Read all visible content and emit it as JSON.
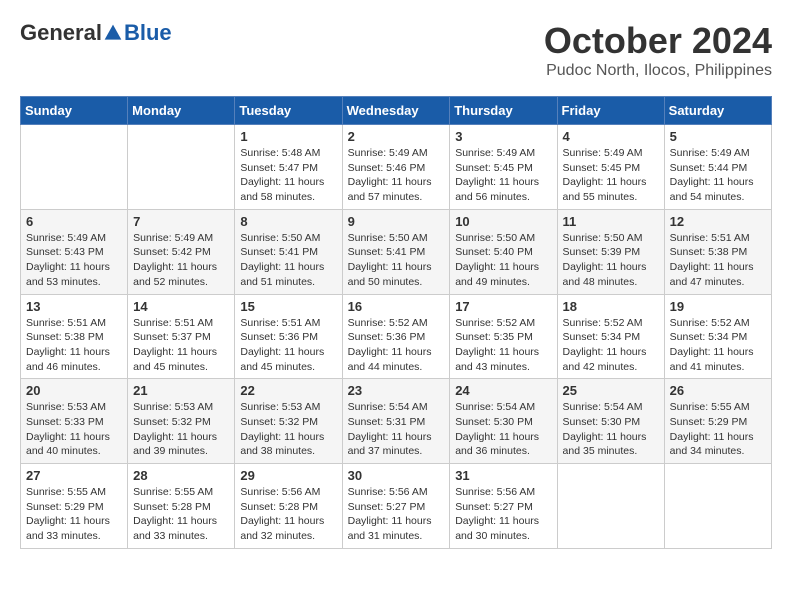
{
  "logo": {
    "general": "General",
    "blue": "Blue"
  },
  "title": "October 2024",
  "location": "Pudoc North, Ilocos, Philippines",
  "weekdays": [
    "Sunday",
    "Monday",
    "Tuesday",
    "Wednesday",
    "Thursday",
    "Friday",
    "Saturday"
  ],
  "weeks": [
    [
      {
        "day": null
      },
      {
        "day": null
      },
      {
        "day": "1",
        "sunrise": "Sunrise: 5:48 AM",
        "sunset": "Sunset: 5:47 PM",
        "daylight": "Daylight: 11 hours and 58 minutes."
      },
      {
        "day": "2",
        "sunrise": "Sunrise: 5:49 AM",
        "sunset": "Sunset: 5:46 PM",
        "daylight": "Daylight: 11 hours and 57 minutes."
      },
      {
        "day": "3",
        "sunrise": "Sunrise: 5:49 AM",
        "sunset": "Sunset: 5:45 PM",
        "daylight": "Daylight: 11 hours and 56 minutes."
      },
      {
        "day": "4",
        "sunrise": "Sunrise: 5:49 AM",
        "sunset": "Sunset: 5:45 PM",
        "daylight": "Daylight: 11 hours and 55 minutes."
      },
      {
        "day": "5",
        "sunrise": "Sunrise: 5:49 AM",
        "sunset": "Sunset: 5:44 PM",
        "daylight": "Daylight: 11 hours and 54 minutes."
      }
    ],
    [
      {
        "day": "6",
        "sunrise": "Sunrise: 5:49 AM",
        "sunset": "Sunset: 5:43 PM",
        "daylight": "Daylight: 11 hours and 53 minutes."
      },
      {
        "day": "7",
        "sunrise": "Sunrise: 5:49 AM",
        "sunset": "Sunset: 5:42 PM",
        "daylight": "Daylight: 11 hours and 52 minutes."
      },
      {
        "day": "8",
        "sunrise": "Sunrise: 5:50 AM",
        "sunset": "Sunset: 5:41 PM",
        "daylight": "Daylight: 11 hours and 51 minutes."
      },
      {
        "day": "9",
        "sunrise": "Sunrise: 5:50 AM",
        "sunset": "Sunset: 5:41 PM",
        "daylight": "Daylight: 11 hours and 50 minutes."
      },
      {
        "day": "10",
        "sunrise": "Sunrise: 5:50 AM",
        "sunset": "Sunset: 5:40 PM",
        "daylight": "Daylight: 11 hours and 49 minutes."
      },
      {
        "day": "11",
        "sunrise": "Sunrise: 5:50 AM",
        "sunset": "Sunset: 5:39 PM",
        "daylight": "Daylight: 11 hours and 48 minutes."
      },
      {
        "day": "12",
        "sunrise": "Sunrise: 5:51 AM",
        "sunset": "Sunset: 5:38 PM",
        "daylight": "Daylight: 11 hours and 47 minutes."
      }
    ],
    [
      {
        "day": "13",
        "sunrise": "Sunrise: 5:51 AM",
        "sunset": "Sunset: 5:38 PM",
        "daylight": "Daylight: 11 hours and 46 minutes."
      },
      {
        "day": "14",
        "sunrise": "Sunrise: 5:51 AM",
        "sunset": "Sunset: 5:37 PM",
        "daylight": "Daylight: 11 hours and 45 minutes."
      },
      {
        "day": "15",
        "sunrise": "Sunrise: 5:51 AM",
        "sunset": "Sunset: 5:36 PM",
        "daylight": "Daylight: 11 hours and 45 minutes."
      },
      {
        "day": "16",
        "sunrise": "Sunrise: 5:52 AM",
        "sunset": "Sunset: 5:36 PM",
        "daylight": "Daylight: 11 hours and 44 minutes."
      },
      {
        "day": "17",
        "sunrise": "Sunrise: 5:52 AM",
        "sunset": "Sunset: 5:35 PM",
        "daylight": "Daylight: 11 hours and 43 minutes."
      },
      {
        "day": "18",
        "sunrise": "Sunrise: 5:52 AM",
        "sunset": "Sunset: 5:34 PM",
        "daylight": "Daylight: 11 hours and 42 minutes."
      },
      {
        "day": "19",
        "sunrise": "Sunrise: 5:52 AM",
        "sunset": "Sunset: 5:34 PM",
        "daylight": "Daylight: 11 hours and 41 minutes."
      }
    ],
    [
      {
        "day": "20",
        "sunrise": "Sunrise: 5:53 AM",
        "sunset": "Sunset: 5:33 PM",
        "daylight": "Daylight: 11 hours and 40 minutes."
      },
      {
        "day": "21",
        "sunrise": "Sunrise: 5:53 AM",
        "sunset": "Sunset: 5:32 PM",
        "daylight": "Daylight: 11 hours and 39 minutes."
      },
      {
        "day": "22",
        "sunrise": "Sunrise: 5:53 AM",
        "sunset": "Sunset: 5:32 PM",
        "daylight": "Daylight: 11 hours and 38 minutes."
      },
      {
        "day": "23",
        "sunrise": "Sunrise: 5:54 AM",
        "sunset": "Sunset: 5:31 PM",
        "daylight": "Daylight: 11 hours and 37 minutes."
      },
      {
        "day": "24",
        "sunrise": "Sunrise: 5:54 AM",
        "sunset": "Sunset: 5:30 PM",
        "daylight": "Daylight: 11 hours and 36 minutes."
      },
      {
        "day": "25",
        "sunrise": "Sunrise: 5:54 AM",
        "sunset": "Sunset: 5:30 PM",
        "daylight": "Daylight: 11 hours and 35 minutes."
      },
      {
        "day": "26",
        "sunrise": "Sunrise: 5:55 AM",
        "sunset": "Sunset: 5:29 PM",
        "daylight": "Daylight: 11 hours and 34 minutes."
      }
    ],
    [
      {
        "day": "27",
        "sunrise": "Sunrise: 5:55 AM",
        "sunset": "Sunset: 5:29 PM",
        "daylight": "Daylight: 11 hours and 33 minutes."
      },
      {
        "day": "28",
        "sunrise": "Sunrise: 5:55 AM",
        "sunset": "Sunset: 5:28 PM",
        "daylight": "Daylight: 11 hours and 33 minutes."
      },
      {
        "day": "29",
        "sunrise": "Sunrise: 5:56 AM",
        "sunset": "Sunset: 5:28 PM",
        "daylight": "Daylight: 11 hours and 32 minutes."
      },
      {
        "day": "30",
        "sunrise": "Sunrise: 5:56 AM",
        "sunset": "Sunset: 5:27 PM",
        "daylight": "Daylight: 11 hours and 31 minutes."
      },
      {
        "day": "31",
        "sunrise": "Sunrise: 5:56 AM",
        "sunset": "Sunset: 5:27 PM",
        "daylight": "Daylight: 11 hours and 30 minutes."
      },
      {
        "day": null
      },
      {
        "day": null
      }
    ]
  ]
}
